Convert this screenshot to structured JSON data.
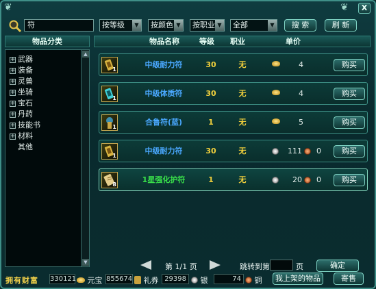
{
  "window": {
    "close_label": "X"
  },
  "search": {
    "value": "符"
  },
  "filters": {
    "level": "按等级",
    "color": "按颜色",
    "job": "按职业",
    "scope": "全部"
  },
  "buttons": {
    "search": "搜 索",
    "refresh": "刷 新",
    "buy": "购买",
    "confirm": "确定",
    "my_listings": "我上架的物品",
    "consign": "寄售"
  },
  "headers": {
    "category": "物品分类",
    "name": "物品名称",
    "level": "等级",
    "job": "职业",
    "price": "单价"
  },
  "categories": [
    {
      "label": "武器",
      "expandable": true
    },
    {
      "label": "装备",
      "expandable": true
    },
    {
      "label": "灵兽",
      "expandable": true
    },
    {
      "label": "坐骑",
      "expandable": true
    },
    {
      "label": "宝石",
      "expandable": true
    },
    {
      "label": "丹药",
      "expandable": true
    },
    {
      "label": "技能书",
      "expandable": true
    },
    {
      "label": "材料",
      "expandable": true
    },
    {
      "label": "其他",
      "expandable": false
    }
  ],
  "items": [
    {
      "name": "中级耐力符",
      "name_color": "#4aa8ff",
      "level": "30",
      "job": "无",
      "count": "1",
      "icon": "scroll-gold-icon",
      "price_type": "gold",
      "gold": "4",
      "silver": "",
      "copper": ""
    },
    {
      "name": "中级体质符",
      "name_color": "#4aa8ff",
      "level": "30",
      "job": "无",
      "count": "1",
      "icon": "scroll-cyan-icon",
      "price_type": "gold",
      "gold": "4",
      "silver": "",
      "copper": ""
    },
    {
      "name": "合鲁符(蓝)",
      "name_color": "#4aa8ff",
      "level": "1",
      "job": "无",
      "count": "1",
      "icon": "talisman-icon",
      "price_type": "gold",
      "gold": "5",
      "silver": "",
      "copper": ""
    },
    {
      "name": "中级耐力符",
      "name_color": "#4aa8ff",
      "level": "30",
      "job": "无",
      "count": "1",
      "icon": "scroll-gold-icon",
      "price_type": "coin",
      "gold": "",
      "silver": "111",
      "copper": "0"
    },
    {
      "name": "1星强化护符",
      "name_color": "#39e04a",
      "level": "1",
      "job": "无",
      "count": "8",
      "icon": "scroll-paper-icon",
      "price_type": "coin",
      "gold": "",
      "silver": "20",
      "copper": "0"
    }
  ],
  "paging": {
    "page_label": "第 1/1 页",
    "jump_label": "跳转到第",
    "page_suffix": "页"
  },
  "wealth": {
    "title": "拥有财富",
    "yuanbao": "330121",
    "yuanbao_label": "元宝",
    "liquan": "855674",
    "liquan_label": "礼券",
    "silver": "29398",
    "silver_label": "银",
    "copper": "74",
    "copper_label": "铜"
  },
  "colors": {
    "accent": "#3f8f88",
    "gold_text": "#f0cf3c",
    "blue_name": "#4aa8ff",
    "green_name": "#39e04a"
  }
}
